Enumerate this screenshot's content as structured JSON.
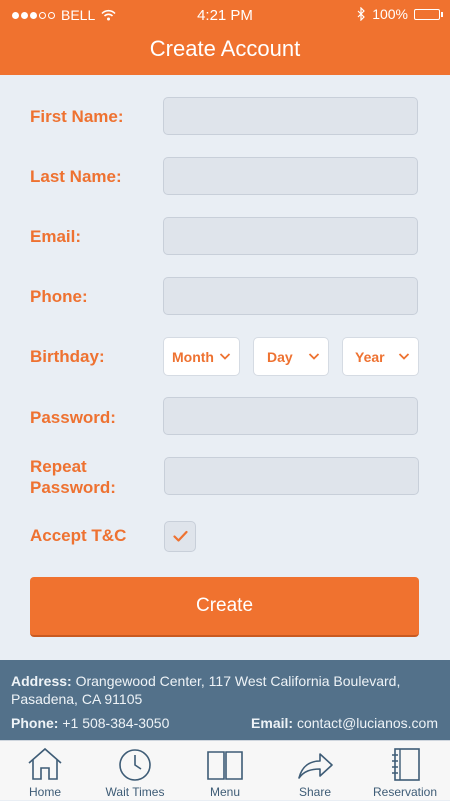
{
  "status_bar": {
    "carrier": "BELL",
    "time": "4:21 PM",
    "battery": "100%"
  },
  "header": {
    "title": "Create Account"
  },
  "form": {
    "first_name_label": "First Name:",
    "last_name_label": "Last Name:",
    "email_label": "Email:",
    "phone_label": "Phone:",
    "birthday_label": "Birthday:",
    "birthday_month": "Month",
    "birthday_day": "Day",
    "birthday_year": "Year",
    "password_label": "Password:",
    "repeat_password_label_line1": "Repeat",
    "repeat_password_label_line2": "Password:",
    "accept_tc_label": "Accept T&C",
    "accept_tc_checked": true,
    "create_label": "Create"
  },
  "footer": {
    "address_label": "Address:",
    "address": "Orangewood Center, 117 West California Boulevard, Pasadena, CA 91105",
    "phone_label": "Phone:",
    "phone": "+1 508-384-3050",
    "email_label": "Email:",
    "email": "contact@lucianos.com"
  },
  "tabs": [
    {
      "label": "Home",
      "icon": "home-icon"
    },
    {
      "label": "Wait Times",
      "icon": "clock-icon"
    },
    {
      "label": "Menu",
      "icon": "book-icon"
    },
    {
      "label": "Share",
      "icon": "share-arrow-icon"
    },
    {
      "label": "Reservation",
      "icon": "notebook-icon"
    }
  ],
  "colors": {
    "accent": "#f0722f",
    "footer_bg": "#53718a",
    "tab_icon": "#3e5c76",
    "page_bg": "#e9eef4"
  }
}
